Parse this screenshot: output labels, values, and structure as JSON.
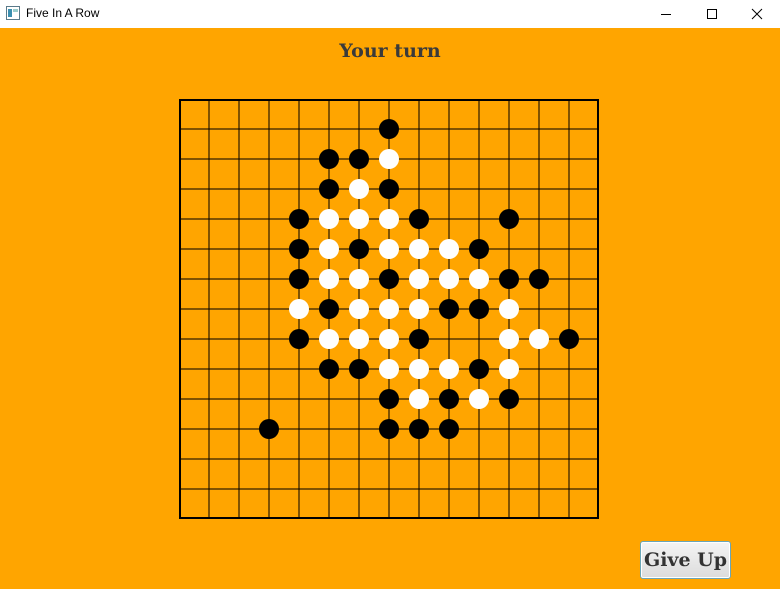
{
  "window": {
    "title": "Five In A Row"
  },
  "status_text": "Your turn",
  "buttons": {
    "give_up": "Give Up"
  },
  "colors": {
    "background": "#ffa500",
    "black_stone": "#000000",
    "white_stone": "#ffffff",
    "grid_line": "#000000"
  },
  "board": {
    "size": 15,
    "rows": [
      "...............",
      ".......B.......",
      ".....BBW.......",
      ".....BWB.......",
      "....BWWWB..B...",
      "....BWBWWWB....",
      "....BWWBWWWBB..",
      "....WBWWWBBW...",
      "....BWWWB..WWB.",
      ".....BBWWWBW...",
      ".......BWBWB...",
      "...B...BBB.....",
      "...............",
      "...............",
      "..............."
    ]
  }
}
